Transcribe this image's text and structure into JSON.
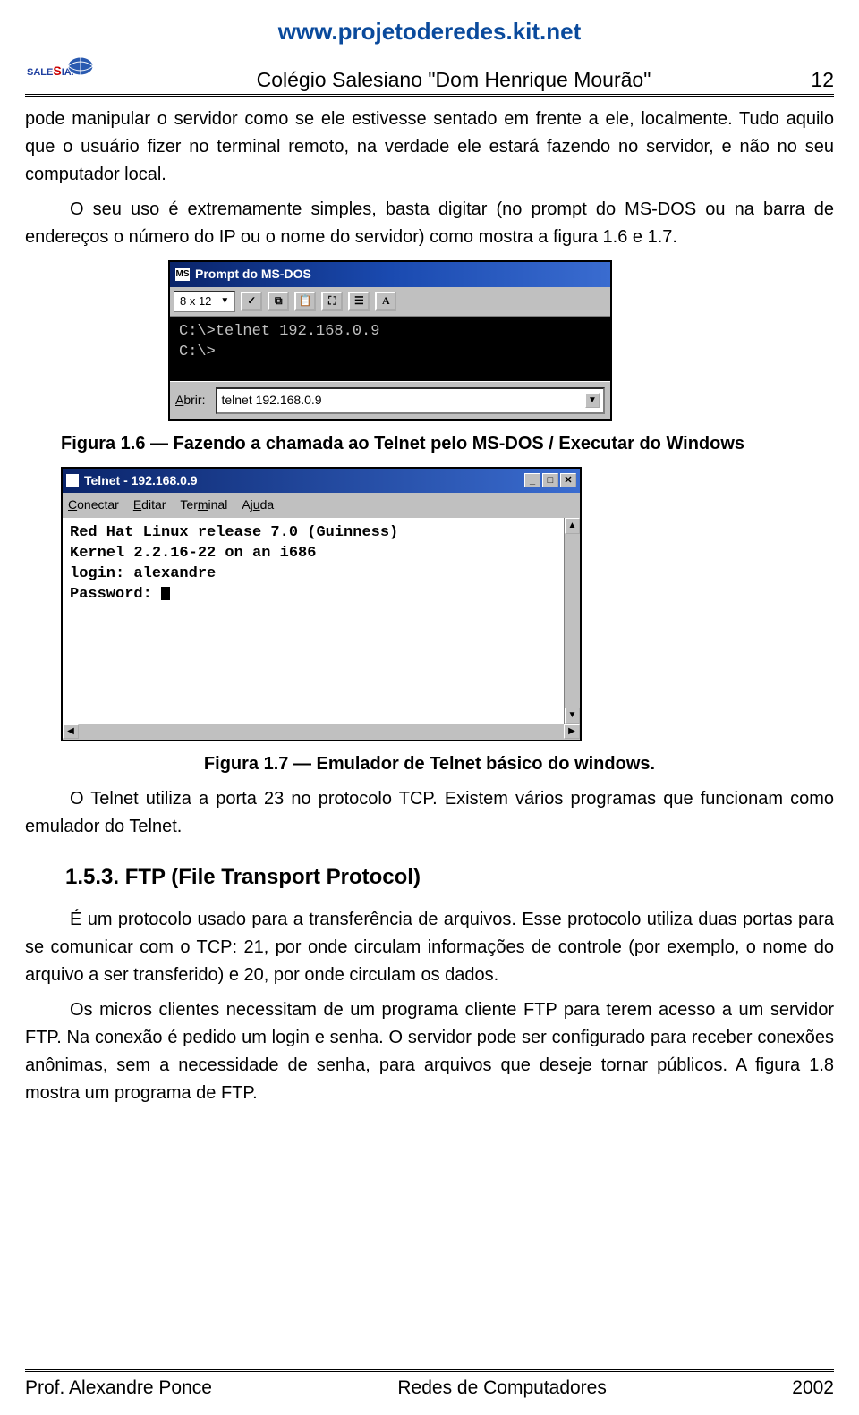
{
  "url_top": "www.projetoderedes.kit.net",
  "logo_text": "SALESIANO",
  "header_title": "Colégio Salesiano \"Dom Henrique Mourão\"",
  "page_number": "12",
  "para1": "pode manipular o servidor como se ele estivesse sentado em frente a ele, localmente. Tudo aquilo que o usuário fizer no terminal remoto, na verdade ele estará fazendo no servidor, e não no seu computador local.",
  "para2": "O seu uso é extremamente simples, basta digitar (no prompt do MS-DOS ou na barra de endereços o número do IP ou o nome do servidor) como mostra a figura 1.6 e 1.7.",
  "dos": {
    "title": "Prompt do MS-DOS",
    "size_label": "8 x 12",
    "tb_mark": "✓",
    "tb_copy": "⧉",
    "tb_paste": "📋",
    "tb_full": "⛶",
    "tb_props": "☰",
    "tb_font": "A",
    "line1": "C:\\>telnet 192.168.0.9",
    "line2": "C:\\>",
    "run_label": "Abrir:",
    "run_value": "telnet 192.168.0.9"
  },
  "caption1": "Figura 1.6 — Fazendo a chamada ao Telnet pelo MS-DOS / Executar do Windows",
  "telnet": {
    "title": "Telnet - 192.168.0.9",
    "btn_min": "_",
    "btn_max": "□",
    "btn_close": "✕",
    "menu1": "Conectar",
    "menu2": "Editar",
    "menu3": "Terminal",
    "menu4": "Ajuda",
    "body": "Red Hat Linux release 7.0 (Guinness)\nKernel 2.2.16-22 on an i686\nlogin: alexandre\nPassword: "
  },
  "caption2": "Figura 1.7 — Emulador de Telnet básico do windows.",
  "para3": "O Telnet utiliza a porta 23 no protocolo TCP. Existem vários programas que funcionam como emulador do Telnet.",
  "section_heading": "1.5.3. FTP (File Transport Protocol)",
  "para4": "É um protocolo usado para a transferência de arquivos. Esse protocolo utiliza duas portas para se comunicar com o TCP: 21, por onde circulam informações de controle (por exemplo, o nome do arquivo a ser transferido) e 20, por onde circulam os dados.",
  "para5": "Os micros clientes necessitam de um programa cliente FTP para terem acesso a um servidor FTP. Na conexão é pedido um login e senha. O servidor pode ser configurado para receber conexões anônimas, sem a necessidade de senha, para arquivos que deseje tornar públicos. A figura 1.8 mostra um programa de FTP.",
  "footer_left": "Prof. Alexandre Ponce",
  "footer_center": "Redes de Computadores",
  "footer_right": "2002"
}
